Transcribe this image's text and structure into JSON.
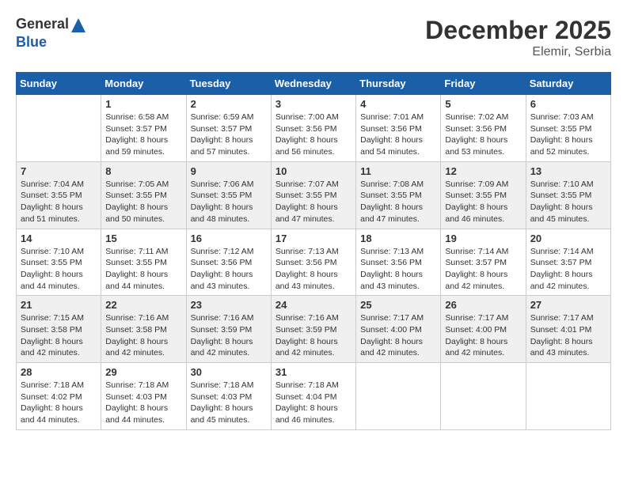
{
  "header": {
    "logo_general": "General",
    "logo_blue": "Blue",
    "month_year": "December 2025",
    "location": "Elemir, Serbia"
  },
  "weekdays": [
    "Sunday",
    "Monday",
    "Tuesday",
    "Wednesday",
    "Thursday",
    "Friday",
    "Saturday"
  ],
  "weeks": [
    [
      {
        "day": "",
        "sunrise": "",
        "sunset": "",
        "daylight": ""
      },
      {
        "day": "1",
        "sunrise": "Sunrise: 6:58 AM",
        "sunset": "Sunset: 3:57 PM",
        "daylight": "Daylight: 8 hours and 59 minutes."
      },
      {
        "day": "2",
        "sunrise": "Sunrise: 6:59 AM",
        "sunset": "Sunset: 3:57 PM",
        "daylight": "Daylight: 8 hours and 57 minutes."
      },
      {
        "day": "3",
        "sunrise": "Sunrise: 7:00 AM",
        "sunset": "Sunset: 3:56 PM",
        "daylight": "Daylight: 8 hours and 56 minutes."
      },
      {
        "day": "4",
        "sunrise": "Sunrise: 7:01 AM",
        "sunset": "Sunset: 3:56 PM",
        "daylight": "Daylight: 8 hours and 54 minutes."
      },
      {
        "day": "5",
        "sunrise": "Sunrise: 7:02 AM",
        "sunset": "Sunset: 3:56 PM",
        "daylight": "Daylight: 8 hours and 53 minutes."
      },
      {
        "day": "6",
        "sunrise": "Sunrise: 7:03 AM",
        "sunset": "Sunset: 3:55 PM",
        "daylight": "Daylight: 8 hours and 52 minutes."
      }
    ],
    [
      {
        "day": "7",
        "sunrise": "Sunrise: 7:04 AM",
        "sunset": "Sunset: 3:55 PM",
        "daylight": "Daylight: 8 hours and 51 minutes."
      },
      {
        "day": "8",
        "sunrise": "Sunrise: 7:05 AM",
        "sunset": "Sunset: 3:55 PM",
        "daylight": "Daylight: 8 hours and 50 minutes."
      },
      {
        "day": "9",
        "sunrise": "Sunrise: 7:06 AM",
        "sunset": "Sunset: 3:55 PM",
        "daylight": "Daylight: 8 hours and 48 minutes."
      },
      {
        "day": "10",
        "sunrise": "Sunrise: 7:07 AM",
        "sunset": "Sunset: 3:55 PM",
        "daylight": "Daylight: 8 hours and 47 minutes."
      },
      {
        "day": "11",
        "sunrise": "Sunrise: 7:08 AM",
        "sunset": "Sunset: 3:55 PM",
        "daylight": "Daylight: 8 hours and 47 minutes."
      },
      {
        "day": "12",
        "sunrise": "Sunrise: 7:09 AM",
        "sunset": "Sunset: 3:55 PM",
        "daylight": "Daylight: 8 hours and 46 minutes."
      },
      {
        "day": "13",
        "sunrise": "Sunrise: 7:10 AM",
        "sunset": "Sunset: 3:55 PM",
        "daylight": "Daylight: 8 hours and 45 minutes."
      }
    ],
    [
      {
        "day": "14",
        "sunrise": "Sunrise: 7:10 AM",
        "sunset": "Sunset: 3:55 PM",
        "daylight": "Daylight: 8 hours and 44 minutes."
      },
      {
        "day": "15",
        "sunrise": "Sunrise: 7:11 AM",
        "sunset": "Sunset: 3:55 PM",
        "daylight": "Daylight: 8 hours and 44 minutes."
      },
      {
        "day": "16",
        "sunrise": "Sunrise: 7:12 AM",
        "sunset": "Sunset: 3:56 PM",
        "daylight": "Daylight: 8 hours and 43 minutes."
      },
      {
        "day": "17",
        "sunrise": "Sunrise: 7:13 AM",
        "sunset": "Sunset: 3:56 PM",
        "daylight": "Daylight: 8 hours and 43 minutes."
      },
      {
        "day": "18",
        "sunrise": "Sunrise: 7:13 AM",
        "sunset": "Sunset: 3:56 PM",
        "daylight": "Daylight: 8 hours and 43 minutes."
      },
      {
        "day": "19",
        "sunrise": "Sunrise: 7:14 AM",
        "sunset": "Sunset: 3:57 PM",
        "daylight": "Daylight: 8 hours and 42 minutes."
      },
      {
        "day": "20",
        "sunrise": "Sunrise: 7:14 AM",
        "sunset": "Sunset: 3:57 PM",
        "daylight": "Daylight: 8 hours and 42 minutes."
      }
    ],
    [
      {
        "day": "21",
        "sunrise": "Sunrise: 7:15 AM",
        "sunset": "Sunset: 3:58 PM",
        "daylight": "Daylight: 8 hours and 42 minutes."
      },
      {
        "day": "22",
        "sunrise": "Sunrise: 7:16 AM",
        "sunset": "Sunset: 3:58 PM",
        "daylight": "Daylight: 8 hours and 42 minutes."
      },
      {
        "day": "23",
        "sunrise": "Sunrise: 7:16 AM",
        "sunset": "Sunset: 3:59 PM",
        "daylight": "Daylight: 8 hours and 42 minutes."
      },
      {
        "day": "24",
        "sunrise": "Sunrise: 7:16 AM",
        "sunset": "Sunset: 3:59 PM",
        "daylight": "Daylight: 8 hours and 42 minutes."
      },
      {
        "day": "25",
        "sunrise": "Sunrise: 7:17 AM",
        "sunset": "Sunset: 4:00 PM",
        "daylight": "Daylight: 8 hours and 42 minutes."
      },
      {
        "day": "26",
        "sunrise": "Sunrise: 7:17 AM",
        "sunset": "Sunset: 4:00 PM",
        "daylight": "Daylight: 8 hours and 42 minutes."
      },
      {
        "day": "27",
        "sunrise": "Sunrise: 7:17 AM",
        "sunset": "Sunset: 4:01 PM",
        "daylight": "Daylight: 8 hours and 43 minutes."
      }
    ],
    [
      {
        "day": "28",
        "sunrise": "Sunrise: 7:18 AM",
        "sunset": "Sunset: 4:02 PM",
        "daylight": "Daylight: 8 hours and 44 minutes."
      },
      {
        "day": "29",
        "sunrise": "Sunrise: 7:18 AM",
        "sunset": "Sunset: 4:03 PM",
        "daylight": "Daylight: 8 hours and 44 minutes."
      },
      {
        "day": "30",
        "sunrise": "Sunrise: 7:18 AM",
        "sunset": "Sunset: 4:03 PM",
        "daylight": "Daylight: 8 hours and 45 minutes."
      },
      {
        "day": "31",
        "sunrise": "Sunrise: 7:18 AM",
        "sunset": "Sunset: 4:04 PM",
        "daylight": "Daylight: 8 hours and 46 minutes."
      },
      {
        "day": "",
        "sunrise": "",
        "sunset": "",
        "daylight": ""
      },
      {
        "day": "",
        "sunrise": "",
        "sunset": "",
        "daylight": ""
      },
      {
        "day": "",
        "sunrise": "",
        "sunset": "",
        "daylight": ""
      }
    ]
  ]
}
